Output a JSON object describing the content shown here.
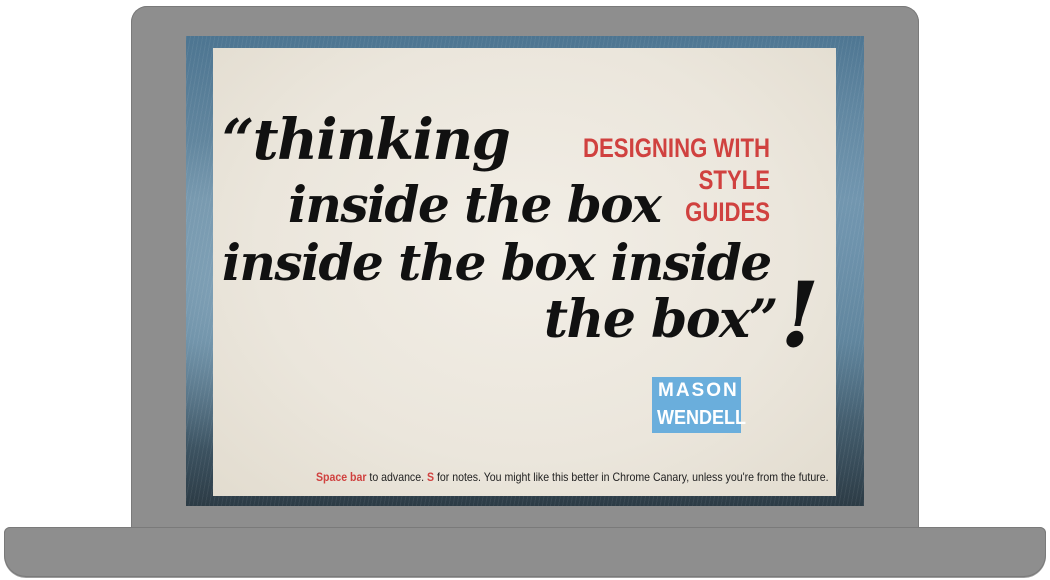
{
  "slide": {
    "quote_lines": [
      "“thinking",
      "inside the box",
      "inside the box inside",
      "the box”"
    ],
    "exclamation": "!",
    "title_lines": [
      "DESIGNING WITH STYLE",
      "GUIDES"
    ],
    "author_first": "MASON",
    "author_last": "WENDELL",
    "instructions": {
      "key1": "Space bar",
      "text1": " to advance. ",
      "key2": "S",
      "text2": " for notes. You might like this better in Chrome Canary, unless you're from the future."
    }
  },
  "colors": {
    "accent_red": "#d0413f",
    "author_badge_blue": "#6aaedc",
    "laptop_gray": "#8e8e8e",
    "slide_paper": "#ebe6dc"
  }
}
